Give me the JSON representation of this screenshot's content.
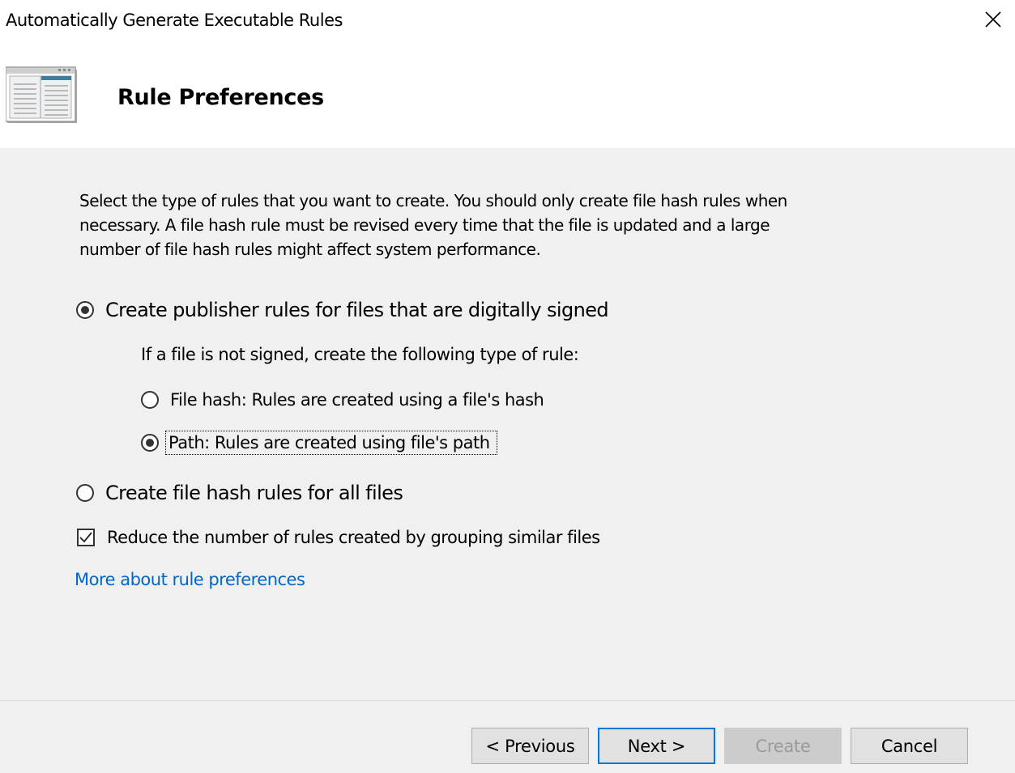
{
  "window": {
    "title": "Automatically Generate Executable Rules",
    "close_icon": "close-icon"
  },
  "header": {
    "icon": "window-list-icon",
    "title": "Rule Preferences"
  },
  "content": {
    "description": "Select the type of rules that you want to create. You should only create file hash rules when necessary. A file hash rule must be revised every time that the file is updated and a large number of file hash rules might affect system performance.",
    "publisher_option": {
      "label": "Create publisher rules for files that are digitally signed",
      "checked": true
    },
    "unsigned_text": "If a file is not signed, create the following type of rule:",
    "file_hash_option": {
      "label": "File hash: Rules are created using a file's hash",
      "checked": false
    },
    "path_option": {
      "label": "Path: Rules are created using file's path",
      "checked": true,
      "focused": true
    },
    "hash_all_option": {
      "label": "Create file hash rules for all files",
      "checked": false
    },
    "group_option": {
      "label": "Reduce the number of rules created by grouping similar files",
      "checked": true
    },
    "more_link": "More about rule preferences"
  },
  "footer": {
    "previous": "< Previous",
    "next": "Next >",
    "create": "Create",
    "cancel": "Cancel"
  },
  "colors": {
    "link": "#0066cc",
    "focus_border": "#0078d7",
    "disabled_text": "#9a9a9a",
    "background": "#f0f0f0"
  }
}
